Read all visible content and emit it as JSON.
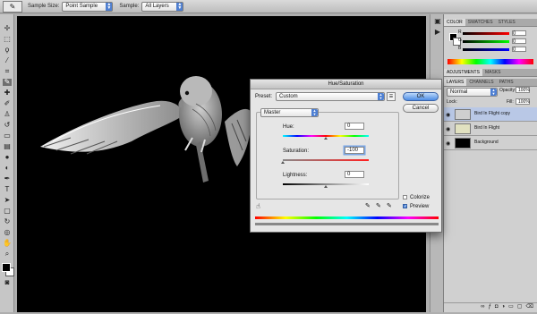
{
  "options_bar": {
    "sample_size_label": "Sample Size:",
    "sample_size_value": "Point Sample",
    "sample_label": "Sample:",
    "sample_value": "All Layers"
  },
  "color_panel": {
    "tabs": [
      "COLOR",
      "SWATCHES",
      "STYLES"
    ],
    "channels": [
      {
        "label": "R",
        "value": "0",
        "color": "#d02020"
      },
      {
        "label": "G",
        "value": "0",
        "color": "#20a020"
      },
      {
        "label": "B",
        "value": "0",
        "color": "#2040d0"
      }
    ]
  },
  "adjust_panel": {
    "tabs": [
      "ADJUSTMENTS",
      "MASKS"
    ]
  },
  "layers_panel": {
    "tabs": [
      "LAYERS",
      "CHANNELS",
      "PATHS"
    ],
    "blend_mode": "Normal",
    "opacity_label": "Opacity:",
    "opacity_value": "100%",
    "lock_label": "Lock:",
    "fill_label": "Fill:",
    "fill_value": "100%",
    "layers": [
      {
        "name": "Bird In Flight copy",
        "selected": true
      },
      {
        "name": "Bird In Flight",
        "selected": false
      },
      {
        "name": "Background",
        "selected": false
      }
    ]
  },
  "dialog": {
    "title": "Hue/Saturation",
    "preset_label": "Preset:",
    "preset_value": "Custom",
    "ok_label": "OK",
    "cancel_label": "Cancel",
    "channel_value": "Master",
    "hue_label": "Hue:",
    "hue_value": "0",
    "saturation_label": "Saturation:",
    "saturation_value": "-100",
    "lightness_label": "Lightness:",
    "lightness_value": "0",
    "colorize_label": "Colorize",
    "colorize_checked": false,
    "preview_label": "Preview",
    "preview_checked": true
  },
  "icons": {
    "eyedropper": "eyedropper-icon",
    "eye": "eye-icon",
    "hand": "targeted-adjustment-icon"
  }
}
